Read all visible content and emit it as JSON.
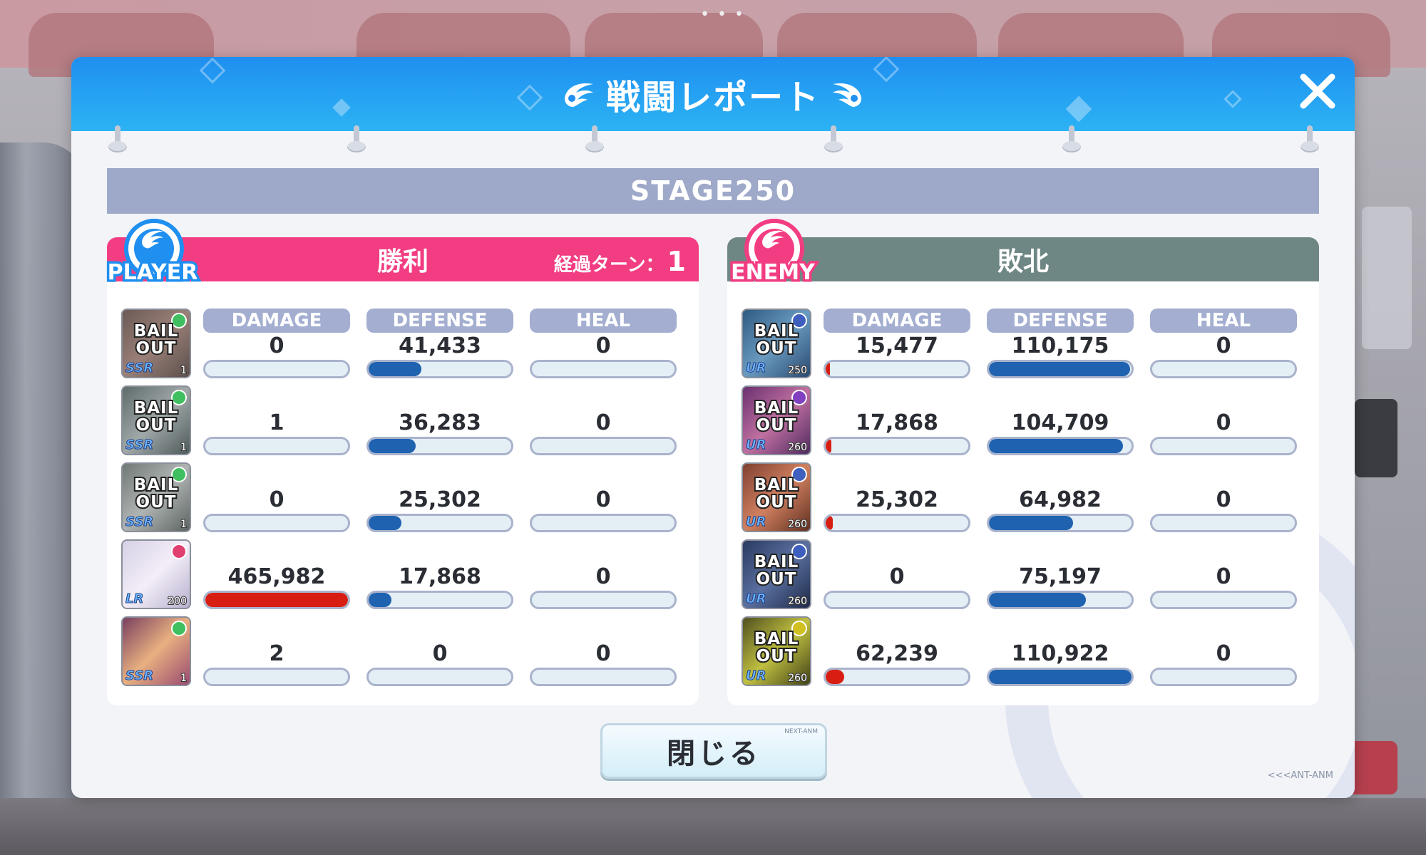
{
  "dialog": {
    "title": "戦闘レポート",
    "stage": "STAGE250",
    "close_label": "閉じる",
    "button_brand": "NEXT-ANM",
    "footer_brand": "<<<ANT-ANM"
  },
  "player": {
    "badge": "PLAYER",
    "result": "勝利",
    "turns_label": "経過ターン：",
    "turns_value": "1",
    "headers": [
      "DAMAGE",
      "DEFENSE",
      "HEAL"
    ],
    "units": [
      {
        "label": "BAIL OUT",
        "rarity": "SSR",
        "level": "1",
        "damage": "0",
        "defense": "41,433",
        "heal": "0",
        "damage_fill": 0,
        "defense_fill": 0.37,
        "heal_fill": 0
      },
      {
        "label": "BAIL OUT",
        "rarity": "SSR",
        "level": "1",
        "damage": "1",
        "defense": "36,283",
        "heal": "0",
        "damage_fill": 0,
        "defense_fill": 0.33,
        "heal_fill": 0
      },
      {
        "label": "BAIL OUT",
        "rarity": "SSR",
        "level": "1",
        "damage": "0",
        "defense": "25,302",
        "heal": "0",
        "damage_fill": 0,
        "defense_fill": 0.23,
        "heal_fill": 0
      },
      {
        "label": "",
        "rarity": "LR",
        "level": "200",
        "damage": "465,982",
        "defense": "17,868",
        "heal": "0",
        "damage_fill": 1.0,
        "defense_fill": 0.16,
        "heal_fill": 0
      },
      {
        "label": "",
        "rarity": "SSR",
        "level": "1",
        "damage": "2",
        "defense": "0",
        "heal": "0",
        "damage_fill": 0,
        "defense_fill": 0,
        "heal_fill": 0
      }
    ]
  },
  "enemy": {
    "badge": "ENEMY",
    "result": "敗北",
    "headers": [
      "DAMAGE",
      "DEFENSE",
      "HEAL"
    ],
    "units": [
      {
        "label": "BAIL OUT",
        "rarity": "UR",
        "level": "250",
        "damage": "15,477",
        "defense": "110,175",
        "heal": "0",
        "damage_fill": 0.03,
        "defense_fill": 0.99,
        "heal_fill": 0
      },
      {
        "label": "BAIL OUT",
        "rarity": "UR",
        "level": "260",
        "damage": "17,868",
        "defense": "104,709",
        "heal": "0",
        "damage_fill": 0.04,
        "defense_fill": 0.94,
        "heal_fill": 0
      },
      {
        "label": "BAIL OUT",
        "rarity": "UR",
        "level": "260",
        "damage": "25,302",
        "defense": "64,982",
        "heal": "0",
        "damage_fill": 0.05,
        "defense_fill": 0.59,
        "heal_fill": 0
      },
      {
        "label": "BAIL OUT",
        "rarity": "UR",
        "level": "260",
        "damage": "0",
        "defense": "75,197",
        "heal": "0",
        "damage_fill": 0,
        "defense_fill": 0.68,
        "heal_fill": 0
      },
      {
        "label": "BAIL OUT",
        "rarity": "UR",
        "level": "260",
        "damage": "62,239",
        "defense": "110,922",
        "heal": "0",
        "damage_fill": 0.13,
        "defense_fill": 1.0,
        "heal_fill": 0
      }
    ]
  },
  "colors": {
    "header_blue": "#1f8ff0",
    "player_pink": "#f23d82",
    "enemy_gray": "#6f8784",
    "damage_red": "#d81e12",
    "defense_blue": "#1f62b0"
  },
  "icons": {
    "close": "close-x-icon",
    "wing": "wing-icon"
  }
}
